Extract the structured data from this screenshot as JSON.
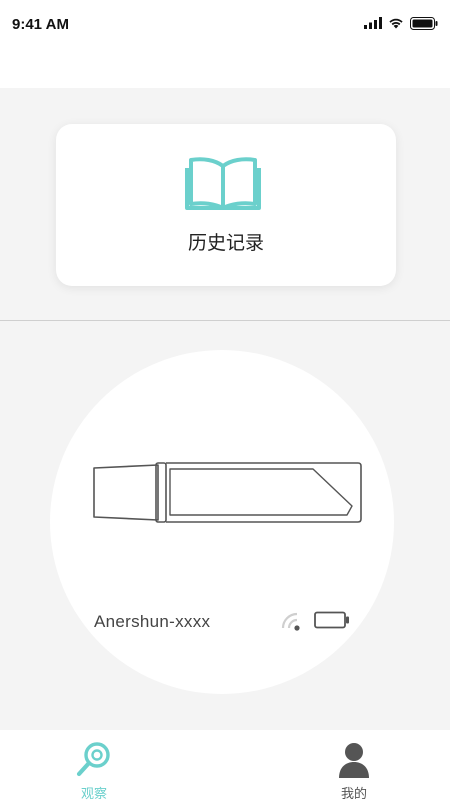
{
  "status_bar": {
    "time": "9:41 AM",
    "icons": [
      "cellular-signal-icon",
      "wifi-icon",
      "battery-icon"
    ]
  },
  "history": {
    "label": "历史记录",
    "icon": "book-icon"
  },
  "device": {
    "name": "Anershun-xxxx",
    "icons": [
      "wifi-signal-icon",
      "battery-icon"
    ]
  },
  "tab_bar": {
    "tabs": [
      {
        "label": "观察",
        "icon": "search-observe-icon",
        "active": true
      },
      {
        "label": "我的",
        "icon": "profile-icon",
        "active": false
      }
    ]
  },
  "colors": {
    "accent": "#6bd0cc",
    "background": "#f4f4f4",
    "card": "#ffffff"
  }
}
